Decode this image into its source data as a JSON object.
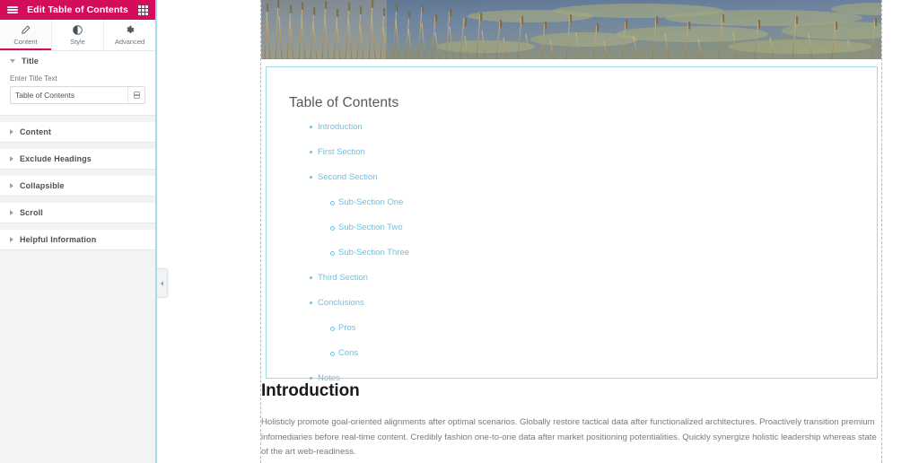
{
  "panel": {
    "header": {
      "title": "Edit Table of Contents",
      "menu_icon": "hamburger-icon",
      "apps_icon": "grid-icon",
      "background": "#d30c5c"
    },
    "tabs": [
      {
        "label": "Content",
        "icon": "pencil-icon",
        "active": true
      },
      {
        "label": "Style",
        "icon": "contrast-icon",
        "active": false
      },
      {
        "label": "Advanced",
        "icon": "gear-icon",
        "active": false
      }
    ],
    "sections": [
      {
        "label": "Title",
        "open": true
      },
      {
        "label": "Content",
        "open": false
      },
      {
        "label": "Exclude Headings",
        "open": false
      },
      {
        "label": "Collapsible",
        "open": false
      },
      {
        "label": "Scroll",
        "open": false
      },
      {
        "label": "Helpful Information",
        "open": false
      }
    ],
    "title_field": {
      "label": "Enter Title Text",
      "value": "Table of Contents",
      "placeholder": "Enter Title Text",
      "dynamic_icon": "database-icon"
    },
    "collapse_handle_icon": "chevron-left-icon"
  },
  "preview": {
    "hero": {
      "alt": "cattails-and-reeds-by-water-photo"
    },
    "toc": {
      "title": "Table of Contents",
      "accent_color": "#6ec1e4",
      "edit_badge_icon": "pencil-icon",
      "items": [
        {
          "label": "Introduction",
          "level": 1
        },
        {
          "label": "First Section",
          "level": 1
        },
        {
          "label": "Second Section",
          "level": 1
        },
        {
          "label": "Sub-Section One",
          "level": 2
        },
        {
          "label": "Sub-Section Two",
          "level": 2
        },
        {
          "label": "Sub-Section Three",
          "level": 2
        },
        {
          "label": "Third Section",
          "level": 1
        },
        {
          "label": "Conclusions",
          "level": 1
        },
        {
          "label": "Pros",
          "level": 2
        },
        {
          "label": "Cons",
          "level": 2
        },
        {
          "label": "Notes",
          "level": 1
        }
      ]
    },
    "article": {
      "heading": "Introduction",
      "paragraph": "Holisticly promote goal-oriented alignments after optimal scenarios. Globally restore tactical data after functionalized architectures. Proactively transition premium infomediaries before real-time content. Credibly fashion one-to-one data after market positioning potentialities. Quickly synergize holistic leadership whereas state of the art web-readiness."
    }
  }
}
